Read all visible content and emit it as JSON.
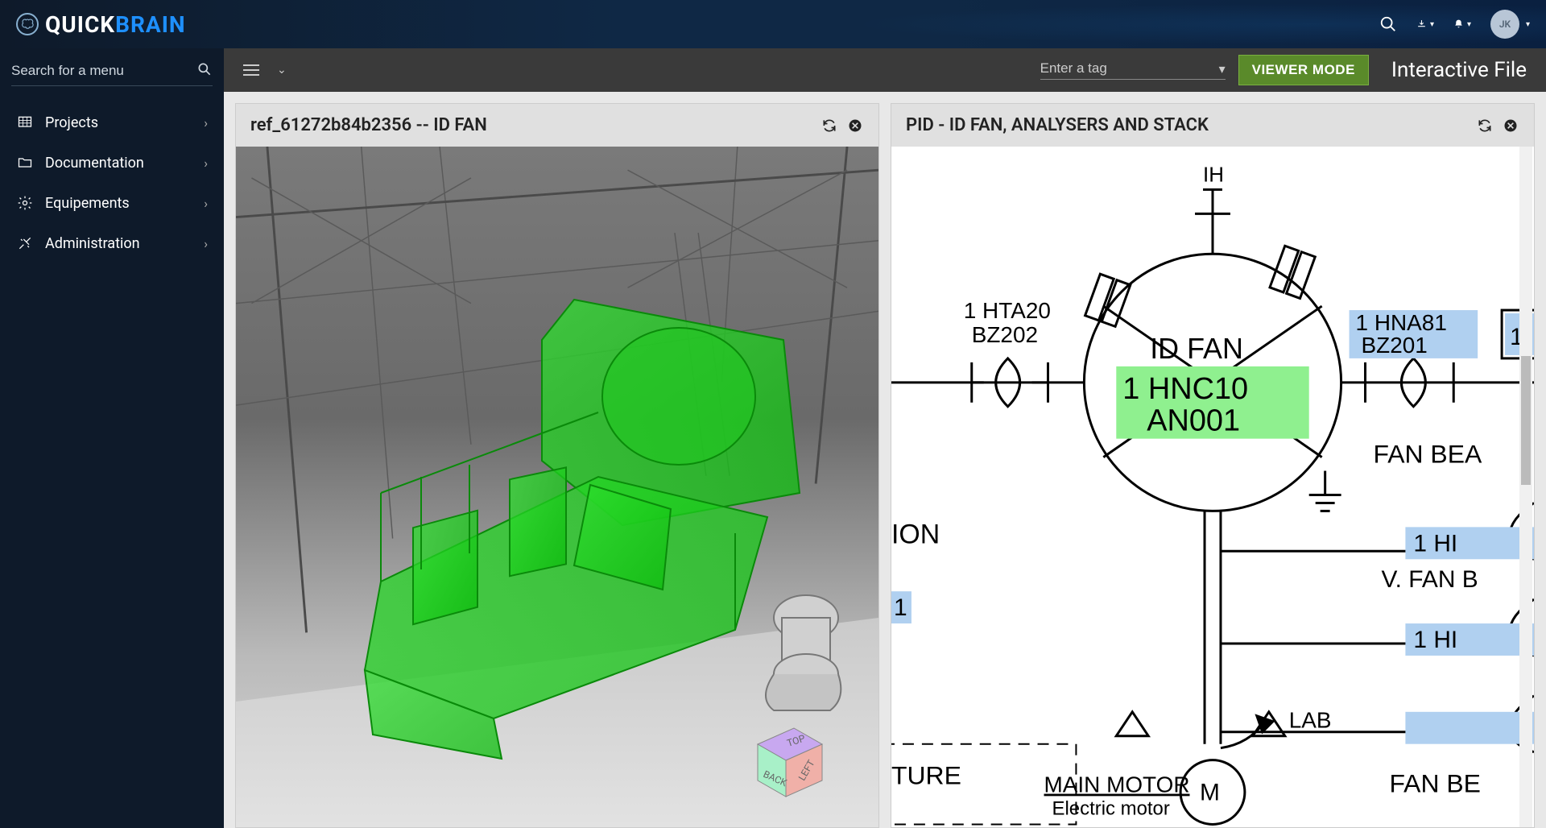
{
  "brand": {
    "name_a": "QUICK",
    "name_b": "BRAIN"
  },
  "user": {
    "initials": "JK"
  },
  "sidebar": {
    "search_placeholder": "Search for a menu",
    "items": [
      {
        "icon": "grid-icon",
        "label": "Projects"
      },
      {
        "icon": "folder-icon",
        "label": "Documentation"
      },
      {
        "icon": "gear-icon",
        "label": "Equipements"
      },
      {
        "icon": "tools-icon",
        "label": "Administration"
      }
    ]
  },
  "toolbar": {
    "tag_placeholder": "Enter a tag",
    "viewer_mode": "VIEWER MODE",
    "page_title": "Interactive File"
  },
  "panels": {
    "left": {
      "title": "ref_61272b84b2356 -- ID FAN"
    },
    "right": {
      "title": "PID - ID FAN, ANALYSERS AND STACK"
    }
  },
  "pid": {
    "tags": {
      "hta20": {
        "line1": "1  HTA20",
        "line2": "BZ202"
      },
      "hna81": {
        "line1": "1  HNA81",
        "line2": "BZ201"
      },
      "hnc10": {
        "line0": "ID FAN",
        "line1": "1  HNC10",
        "line2": "AN001"
      },
      "frag_1": "1",
      "frag_1b": "1",
      "frag_ion": "ION",
      "frag_1h_a": "1  HI",
      "frag_1h_b": "1  HI",
      "frag_vfanb": "V. FAN B",
      "frag_fanbea": "FAN BEA",
      "frag_fanbe": "FAN BE",
      "frag_lab": "LAB",
      "frag_ture": "TURE",
      "frag_mainmotor": "MAIN MOTOR",
      "frag_elecmotor": "Electric motor",
      "ih": "IH"
    },
    "navcube": {
      "top": "TOP",
      "back": "BACK",
      "left": "LEFT"
    }
  }
}
